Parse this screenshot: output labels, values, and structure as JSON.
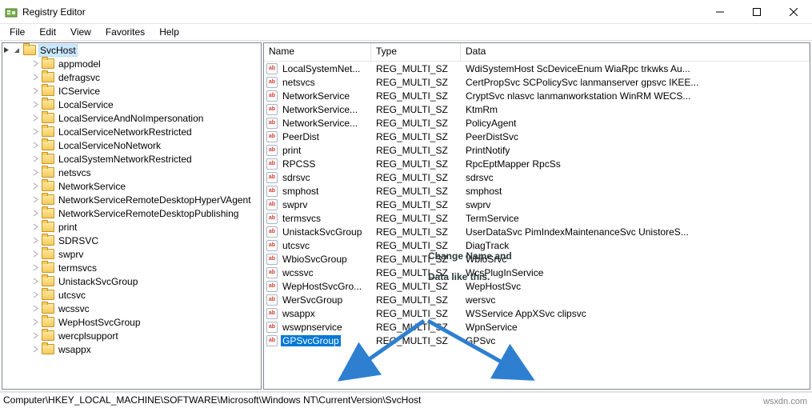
{
  "title": "Registry Editor",
  "menu": [
    "File",
    "Edit",
    "View",
    "Favorites",
    "Help"
  ],
  "tree": {
    "root": "SvcHost",
    "items": [
      "appmodel",
      "defragsvc",
      "ICService",
      "LocalService",
      "LocalServiceAndNoImpersonation",
      "LocalServiceNetworkRestricted",
      "LocalServiceNoNetwork",
      "LocalSystemNetworkRestricted",
      "netsvcs",
      "NetworkService",
      "NetworkServiceRemoteDesktopHyperVAgent",
      "NetworkServiceRemoteDesktopPublishing",
      "print",
      "SDRSVC",
      "swprv",
      "termsvcs",
      "UnistackSvcGroup",
      "utcsvc",
      "wcssvc",
      "WepHostSvcGroup",
      "wercplsupport",
      "wsappx"
    ]
  },
  "columns": {
    "name": "Name",
    "type": "Type",
    "data": "Data"
  },
  "rows": [
    {
      "name": "LocalSystemNet...",
      "type": "REG_MULTI_SZ",
      "data": "WdiSystemHost ScDeviceEnum WiaRpc trkwks Au..."
    },
    {
      "name": "netsvcs",
      "type": "REG_MULTI_SZ",
      "data": "CertPropSvc SCPolicySvc lanmanserver gpsvc IKEE..."
    },
    {
      "name": "NetworkService",
      "type": "REG_MULTI_SZ",
      "data": "CryptSvc nlasvc lanmanworkstation WinRM WECS..."
    },
    {
      "name": "NetworkService...",
      "type": "REG_MULTI_SZ",
      "data": "KtmRm"
    },
    {
      "name": "NetworkService...",
      "type": "REG_MULTI_SZ",
      "data": "PolicyAgent"
    },
    {
      "name": "PeerDist",
      "type": "REG_MULTI_SZ",
      "data": "PeerDistSvc"
    },
    {
      "name": "print",
      "type": "REG_MULTI_SZ",
      "data": "PrintNotify"
    },
    {
      "name": "RPCSS",
      "type": "REG_MULTI_SZ",
      "data": "RpcEptMapper RpcSs"
    },
    {
      "name": "sdrsvc",
      "type": "REG_MULTI_SZ",
      "data": "sdrsvc"
    },
    {
      "name": "smphost",
      "type": "REG_MULTI_SZ",
      "data": "smphost"
    },
    {
      "name": "swprv",
      "type": "REG_MULTI_SZ",
      "data": "swprv"
    },
    {
      "name": "termsvcs",
      "type": "REG_MULTI_SZ",
      "data": "TermService"
    },
    {
      "name": "UnistackSvcGroup",
      "type": "REG_MULTI_SZ",
      "data": "UserDataSvc PimIndexMaintenanceSvc UnistoreS..."
    },
    {
      "name": "utcsvc",
      "type": "REG_MULTI_SZ",
      "data": "DiagTrack"
    },
    {
      "name": "WbioSvcGroup",
      "type": "REG_MULTI_SZ",
      "data": "WbioSrvc"
    },
    {
      "name": "wcssvc",
      "type": "REG_MULTI_SZ",
      "data": "WcsPlugInService"
    },
    {
      "name": "WepHostSvcGro...",
      "type": "REG_MULTI_SZ",
      "data": "WepHostSvc"
    },
    {
      "name": "WerSvcGroup",
      "type": "REG_MULTI_SZ",
      "data": "wersvc"
    },
    {
      "name": "wsappx",
      "type": "REG_MULTI_SZ",
      "data": "WSService AppXSvc clipsvc"
    },
    {
      "name": "wswpnservice",
      "type": "REG_MULTI_SZ",
      "data": "WpnService"
    },
    {
      "name": "GPSvcGroup",
      "type": "REG_MULTI_SZ",
      "data": "GPSvc",
      "selected": true
    }
  ],
  "statusbar": "Computer\\HKEY_LOCAL_MACHINE\\SOFTWARE\\Microsoft\\Windows NT\\CurrentVersion\\SvcHost",
  "annotation": "Change Name and\nData like this.",
  "watermark": "wsxdn.com"
}
